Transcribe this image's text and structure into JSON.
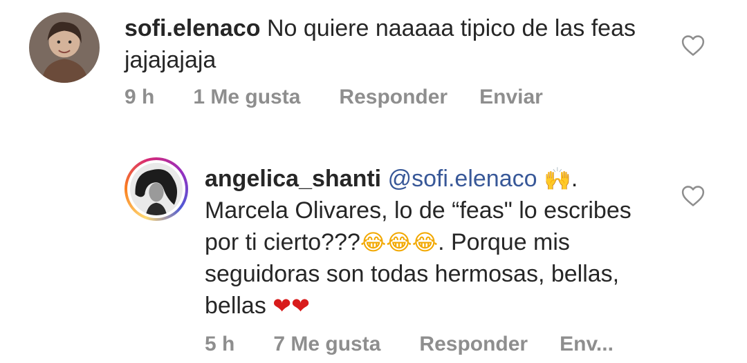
{
  "comments": [
    {
      "username": "sofi.elenaco",
      "text": "No quiere naaaaa tipico de las feas jajajajaja",
      "time": "9 h",
      "likes": "1 Me gusta",
      "reply": "Responder",
      "send": "Enviar"
    },
    {
      "username": "angelica_shanti",
      "mention": "@sofi.elenaco",
      "emoji_hands": "🙌",
      "after_hands": ".",
      "line_text_1": " Marcela Olivares, lo de “feas\" lo escribes por ti cierto???",
      "emoji_laugh": "😂😂😂",
      "line_text_2": ". Porque mis seguidoras son todas hermosas, bellas, bellas ",
      "emoji_hearts": "❤❤",
      "time": "5 h",
      "likes": "7 Me gusta",
      "reply": "Responder",
      "send": "Env..."
    }
  ],
  "icons": {
    "like": "heart-outline-icon"
  },
  "colors": {
    "mention": "#385898",
    "meta": "#8e8e8e",
    "text": "#262626"
  }
}
